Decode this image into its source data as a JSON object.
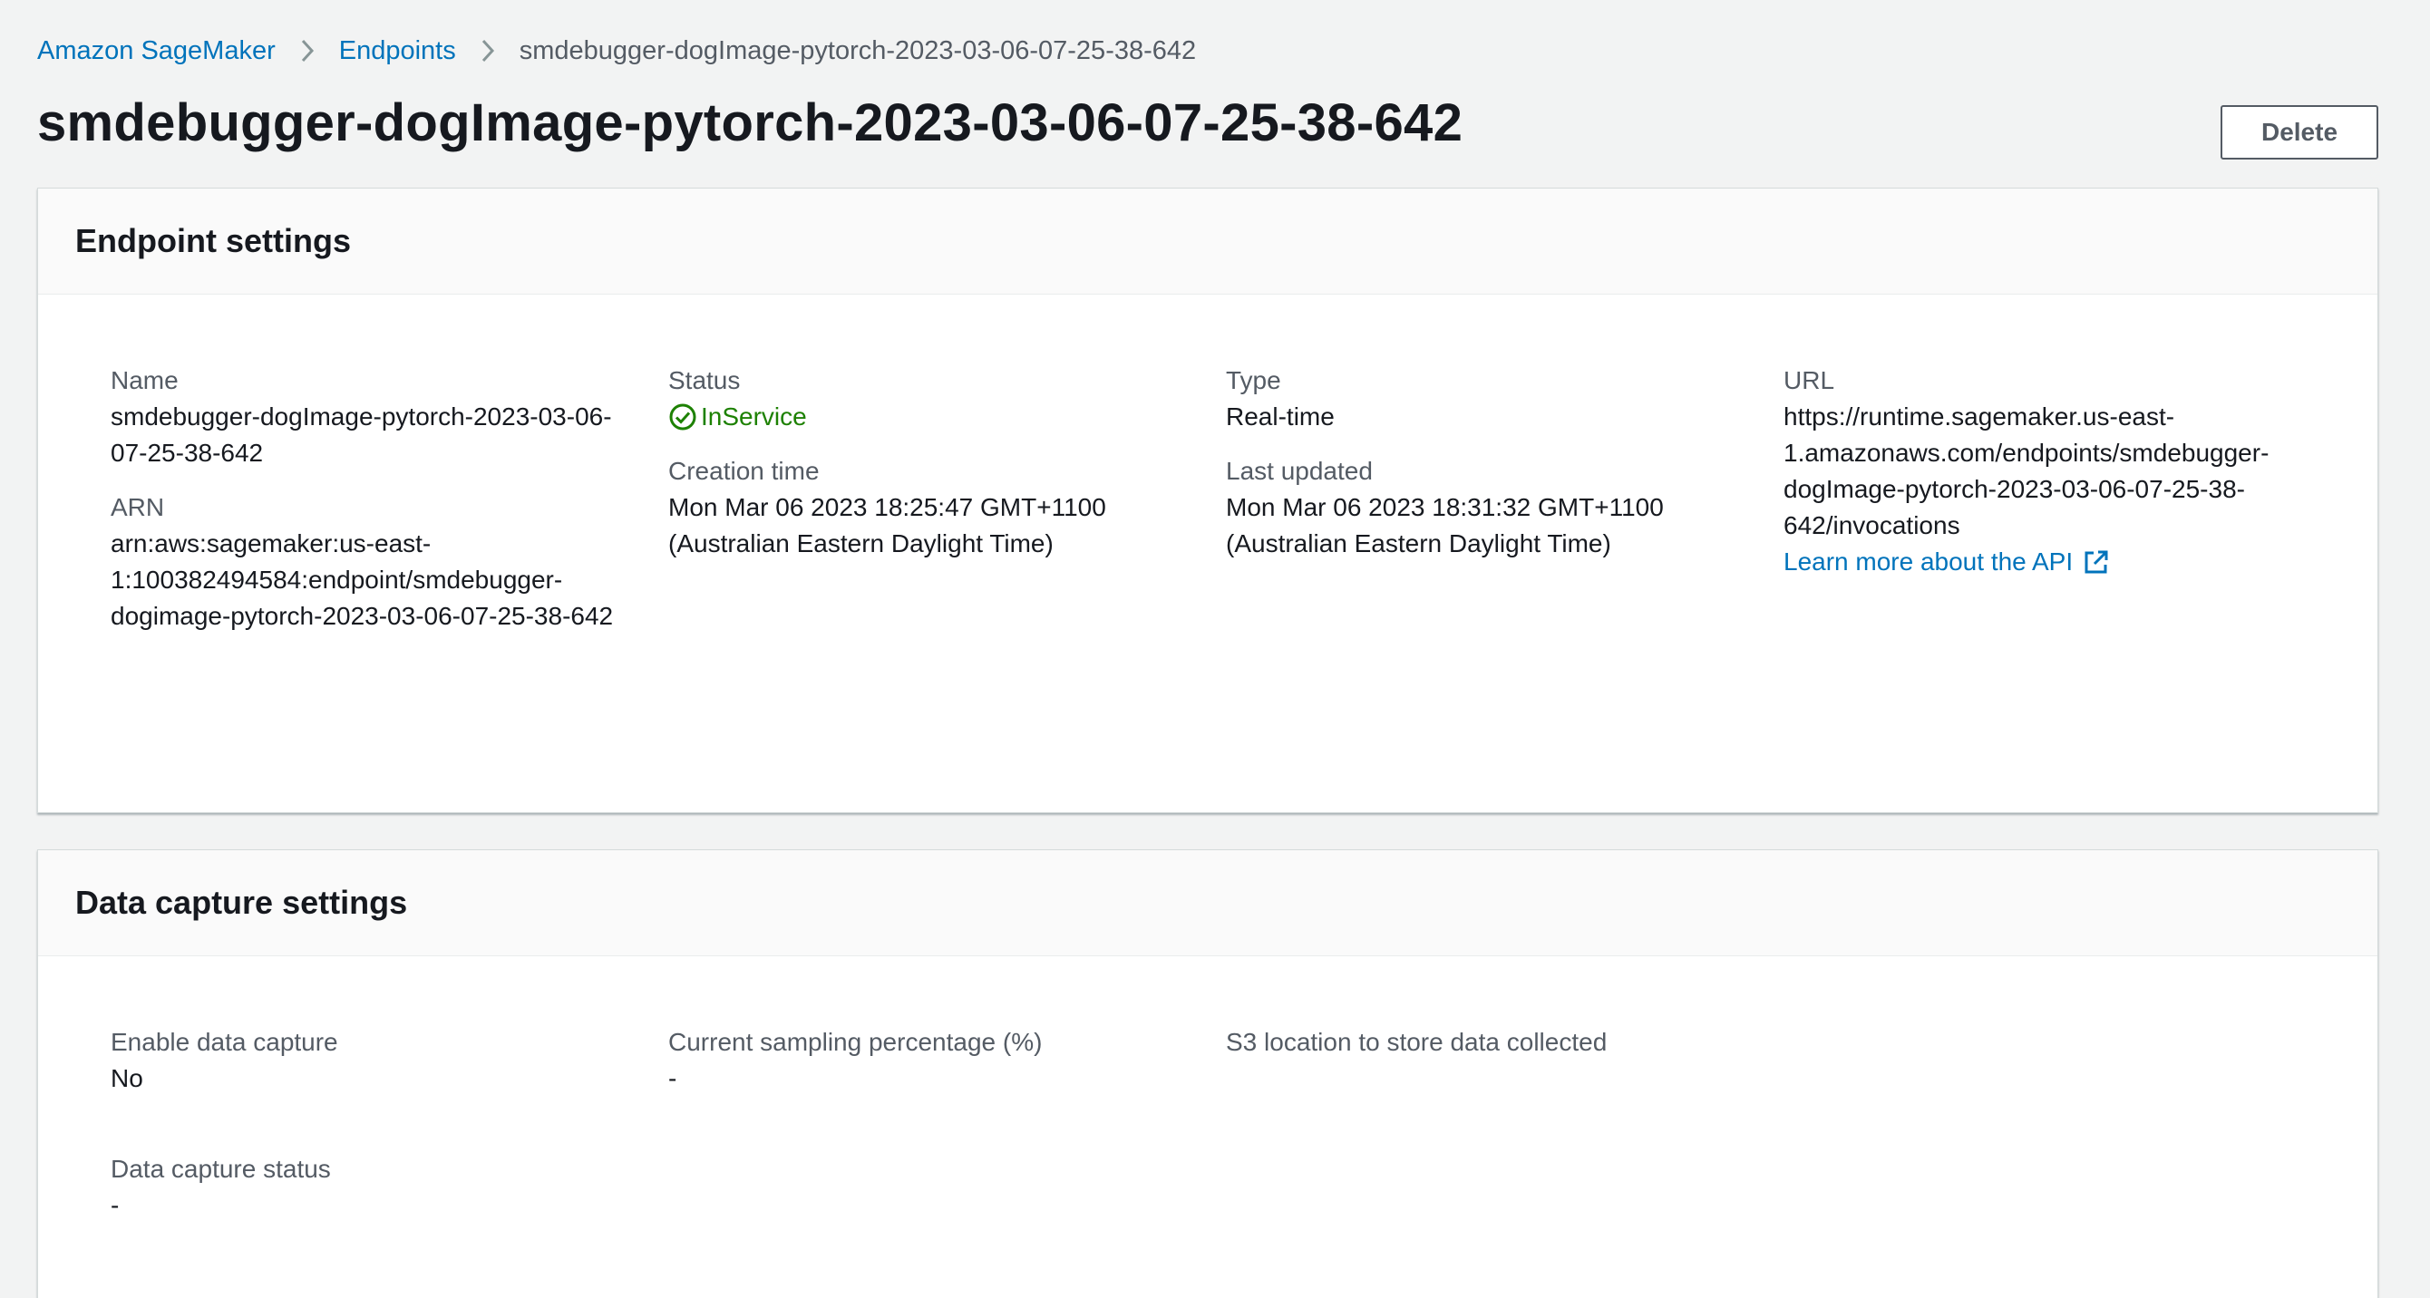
{
  "breadcrumb": {
    "root": "Amazon SageMaker",
    "section": "Endpoints",
    "current": "smdebugger-dogImage-pytorch-2023-03-06-07-25-38-642"
  },
  "page": {
    "title": "smdebugger-dogImage-pytorch-2023-03-06-07-25-38-642",
    "delete_label": "Delete"
  },
  "endpoint_settings": {
    "title": "Endpoint settings",
    "name_label": "Name",
    "name_value": "smdebugger-dogImage-pytorch-2023-03-06-07-25-38-642",
    "arn_label": "ARN",
    "arn_value": "arn:aws:sagemaker:us-east-1:100382494584:endpoint/smdebugger-dogimage-pytorch-2023-03-06-07-25-38-642",
    "status_label": "Status",
    "status_value": "InService",
    "status_color": "#1d8102",
    "creation_label": "Creation time",
    "creation_value": "Mon Mar 06 2023 18:25:47 GMT+1100 (Australian Eastern Daylight Time)",
    "type_label": "Type",
    "type_value": "Real-time",
    "updated_label": "Last updated",
    "updated_value": "Mon Mar 06 2023 18:31:32 GMT+1100 (Australian Eastern Daylight Time)",
    "url_label": "URL",
    "url_value": "https://runtime.sagemaker.us-east-1.amazonaws.com/endpoints/smdebugger-dogImage-pytorch-2023-03-06-07-25-38-642/invocations",
    "api_link": "Learn more about the API"
  },
  "data_capture": {
    "title": "Data capture settings",
    "enable_label": "Enable data capture",
    "enable_value": "No",
    "sampling_label": "Current sampling percentage (%)",
    "sampling_value": "-",
    "s3_label": "S3 location to store data collected",
    "status_label": "Data capture status",
    "status_value": "-"
  },
  "colors": {
    "link": "#0073bb",
    "background": "#f2f3f3",
    "success": "#1d8102"
  },
  "icons": [
    "chevron-right-icon",
    "status-positive-icon",
    "external-link-icon"
  ]
}
